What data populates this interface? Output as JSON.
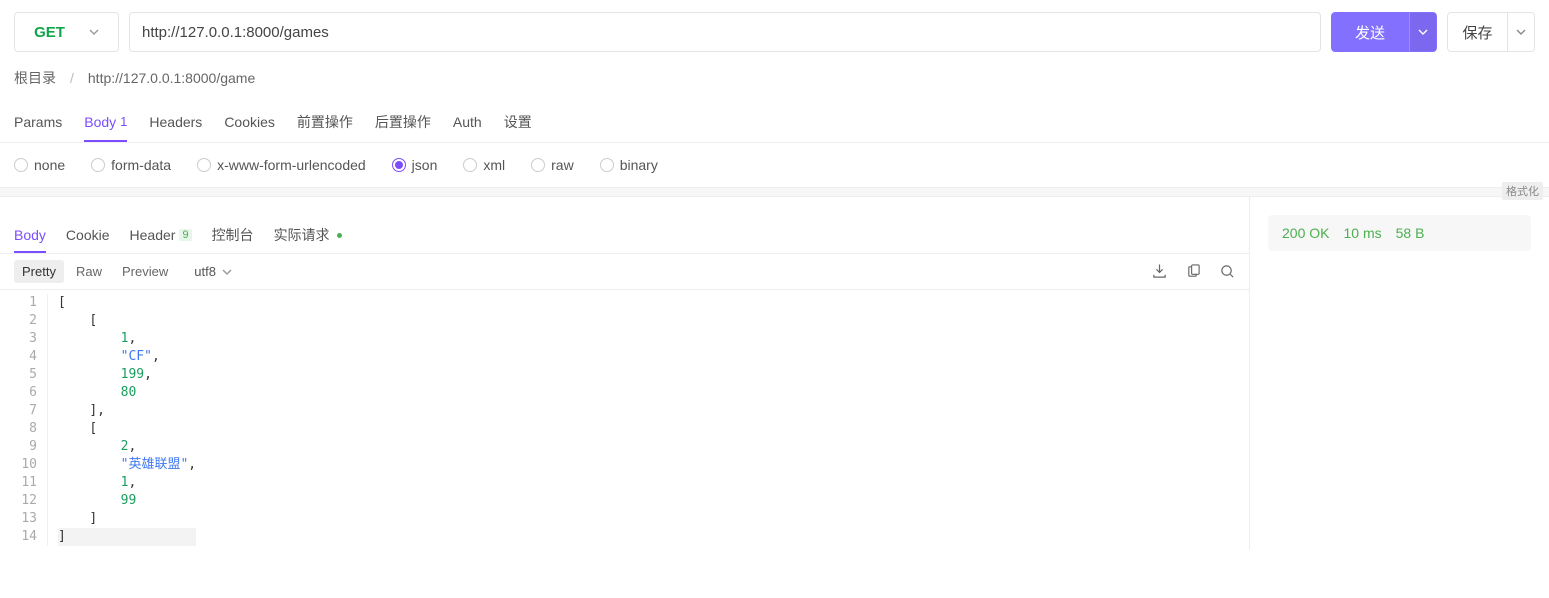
{
  "request": {
    "method": "GET",
    "url": "http://127.0.0.1:8000/games",
    "send_label": "发送",
    "save_label": "保存"
  },
  "breadcrumb": {
    "root": "根目录",
    "current": "http://127.0.0.1:8000/game"
  },
  "req_tabs": {
    "params": "Params",
    "body": "Body",
    "body_count": "1",
    "headers": "Headers",
    "cookies": "Cookies",
    "pre": "前置操作",
    "post": "后置操作",
    "auth": "Auth",
    "settings": "设置"
  },
  "body_types": {
    "none": "none",
    "form_data": "form-data",
    "urlencoded": "x-www-form-urlencoded",
    "json": "json",
    "xml": "xml",
    "raw": "raw",
    "binary": "binary"
  },
  "format_btn": "格式化",
  "resp_tabs": {
    "body": "Body",
    "cookie": "Cookie",
    "header": "Header",
    "header_count": "9",
    "console": "控制台",
    "actual": "实际请求"
  },
  "resp_toolbar": {
    "pretty": "Pretty",
    "raw": "Raw",
    "preview": "Preview",
    "encoding": "utf8"
  },
  "status": {
    "code": "200 OK",
    "time": "10 ms",
    "size": "58 B"
  },
  "response_lines": [
    {
      "n": 1,
      "indent": 0,
      "t": "[",
      "c": "punc"
    },
    {
      "n": 2,
      "indent": 1,
      "t": "[",
      "c": "punc"
    },
    {
      "n": 3,
      "indent": 2,
      "t": "1",
      "c": "num",
      "comma": true
    },
    {
      "n": 4,
      "indent": 2,
      "t": "\"CF\"",
      "c": "str",
      "comma": true
    },
    {
      "n": 5,
      "indent": 2,
      "t": "199",
      "c": "num",
      "comma": true
    },
    {
      "n": 6,
      "indent": 2,
      "t": "80",
      "c": "num"
    },
    {
      "n": 7,
      "indent": 1,
      "t": "]",
      "c": "punc",
      "comma": true
    },
    {
      "n": 8,
      "indent": 1,
      "t": "[",
      "c": "punc"
    },
    {
      "n": 9,
      "indent": 2,
      "t": "2",
      "c": "num",
      "comma": true
    },
    {
      "n": 10,
      "indent": 2,
      "t": "\"英雄联盟\"",
      "c": "str",
      "comma": true
    },
    {
      "n": 11,
      "indent": 2,
      "t": "1",
      "c": "num",
      "comma": true
    },
    {
      "n": 12,
      "indent": 2,
      "t": "99",
      "c": "num"
    },
    {
      "n": 13,
      "indent": 1,
      "t": "]",
      "c": "punc"
    },
    {
      "n": 14,
      "indent": 0,
      "t": "]",
      "c": "punc",
      "cursor": true
    }
  ]
}
